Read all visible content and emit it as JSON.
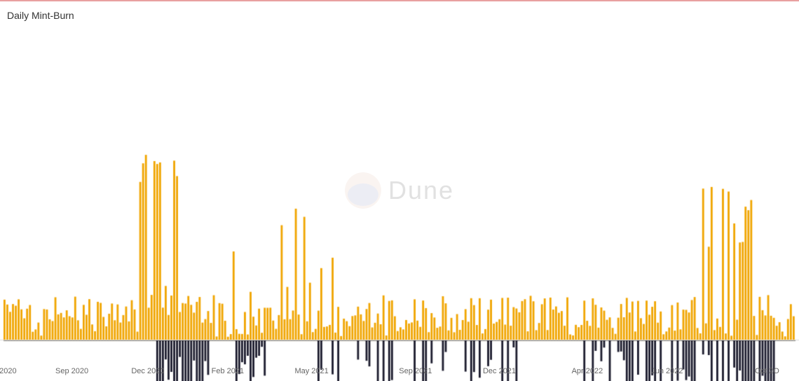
{
  "chart": {
    "title": "Daily Mint-Burn",
    "watermark": "Dune",
    "xLabels": [
      {
        "label": "2020",
        "pct": 0.01
      },
      {
        "label": "Sep 2020",
        "pct": 0.09
      },
      {
        "label": "Dec 2020",
        "pct": 0.185
      },
      {
        "label": "Feb 2021",
        "pct": 0.285
      },
      {
        "label": "May 2021",
        "pct": 0.39
      },
      {
        "label": "Sep 2021",
        "pct": 0.52
      },
      {
        "label": "Dec 2021",
        "pct": 0.625
      },
      {
        "label": "Apr 2022",
        "pct": 0.735
      },
      {
        "label": "Jun 2022",
        "pct": 0.835
      },
      {
        "label": "Oct 2O",
        "pct": 0.96
      }
    ],
    "colors": {
      "positive": "#F0A500",
      "negative": "#1a1a2e",
      "baseline": "#000"
    }
  }
}
